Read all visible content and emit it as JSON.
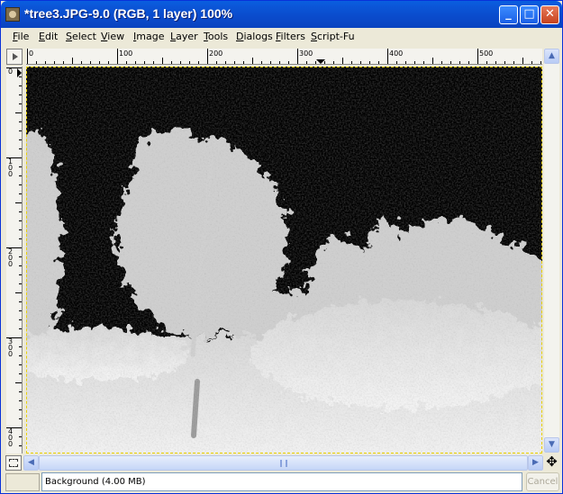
{
  "window": {
    "title": "*tree3.JPG-9.0 (RGB, 1 layer) 100%",
    "minimize_glyph": "_",
    "maximize_glyph": "□",
    "close_glyph": "✕"
  },
  "menubar": {
    "items": [
      {
        "u": "F",
        "rest": "ile"
      },
      {
        "u": "E",
        "rest": "dit"
      },
      {
        "u": "S",
        "rest": "elect"
      },
      {
        "u": "V",
        "rest": "iew"
      },
      {
        "u": "I",
        "rest": "mage"
      },
      {
        "u": "L",
        "rest": "ayer"
      },
      {
        "u": "T",
        "rest": "ools"
      },
      {
        "u": "D",
        "rest": "ialogs"
      },
      {
        "u": "F",
        "rest": "ilters"
      },
      {
        "u": "S",
        "rest": "cript-Fu"
      }
    ]
  },
  "rulers": {
    "horizontal_labels": [
      "0",
      "100",
      "200",
      "300",
      "400",
      "500"
    ],
    "vertical_labels": [
      "0",
      "100",
      "200",
      "300",
      "400"
    ]
  },
  "canvas": {
    "image_description_icon": "inverted-tree-photo",
    "selection_color": "#e8d000"
  },
  "scrollbars": {
    "up_glyph": "▲",
    "down_glyph": "▼",
    "left_glyph": "◀",
    "right_glyph": "▶"
  },
  "status": {
    "layer_text": "Background (4.00 MB)",
    "cancel_label": "Cancel"
  },
  "colors": {
    "titlebar": "#0a4bcc",
    "chrome": "#ece9d8"
  }
}
